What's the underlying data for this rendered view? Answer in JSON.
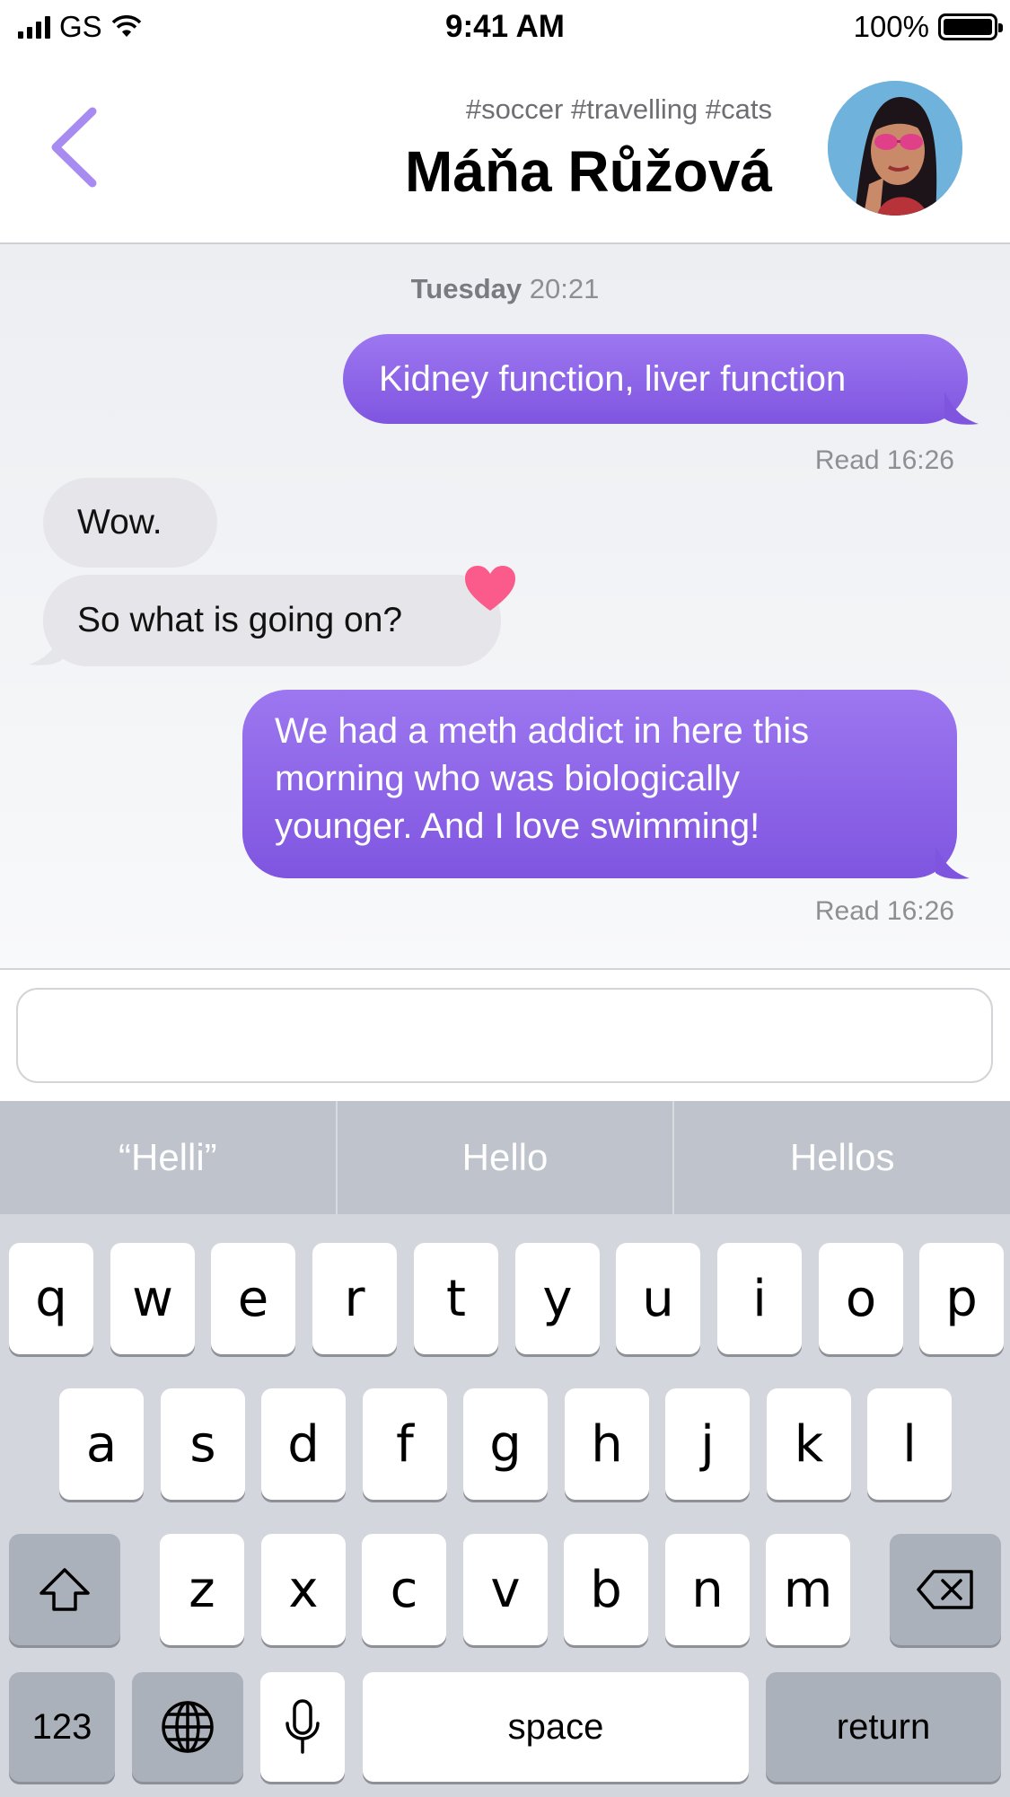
{
  "status_bar": {
    "carrier": "GS",
    "time": "9:41 AM",
    "battery": "100%"
  },
  "header": {
    "tags": "#soccer #travelling #cats",
    "name": "Máňa Růžová"
  },
  "conversation": {
    "timestamp_day": "Tuesday",
    "timestamp_time": "20:21",
    "messages": [
      {
        "from": "me",
        "text": "Kidney function, liver function",
        "status": "Read 16:26"
      },
      {
        "from": "them",
        "text": "Wow."
      },
      {
        "from": "them",
        "text": "So what is going on?",
        "reaction": "heart"
      },
      {
        "from": "me",
        "lines": [
          "We had a meth addict in here this",
          "morning who was biologically",
          "younger. And I love swimming!"
        ],
        "status": "Read 16:26"
      }
    ]
  },
  "input": {
    "value": ""
  },
  "keyboard": {
    "suggestions": [
      "“Helli”",
      "Hello",
      "Hellos"
    ],
    "row1": [
      "q",
      "w",
      "e",
      "r",
      "t",
      "y",
      "u",
      "i",
      "o",
      "p"
    ],
    "row2": [
      "a",
      "s",
      "d",
      "f",
      "g",
      "h",
      "j",
      "k",
      "l"
    ],
    "row3": [
      "z",
      "x",
      "c",
      "v",
      "b",
      "n",
      "m"
    ],
    "numbers_label": "123",
    "space_label": "space",
    "return_label": "return"
  },
  "colors": {
    "accent": "#8a63e8",
    "heart": "#fb5b8a",
    "received_bubble": "#e6e6ea"
  }
}
